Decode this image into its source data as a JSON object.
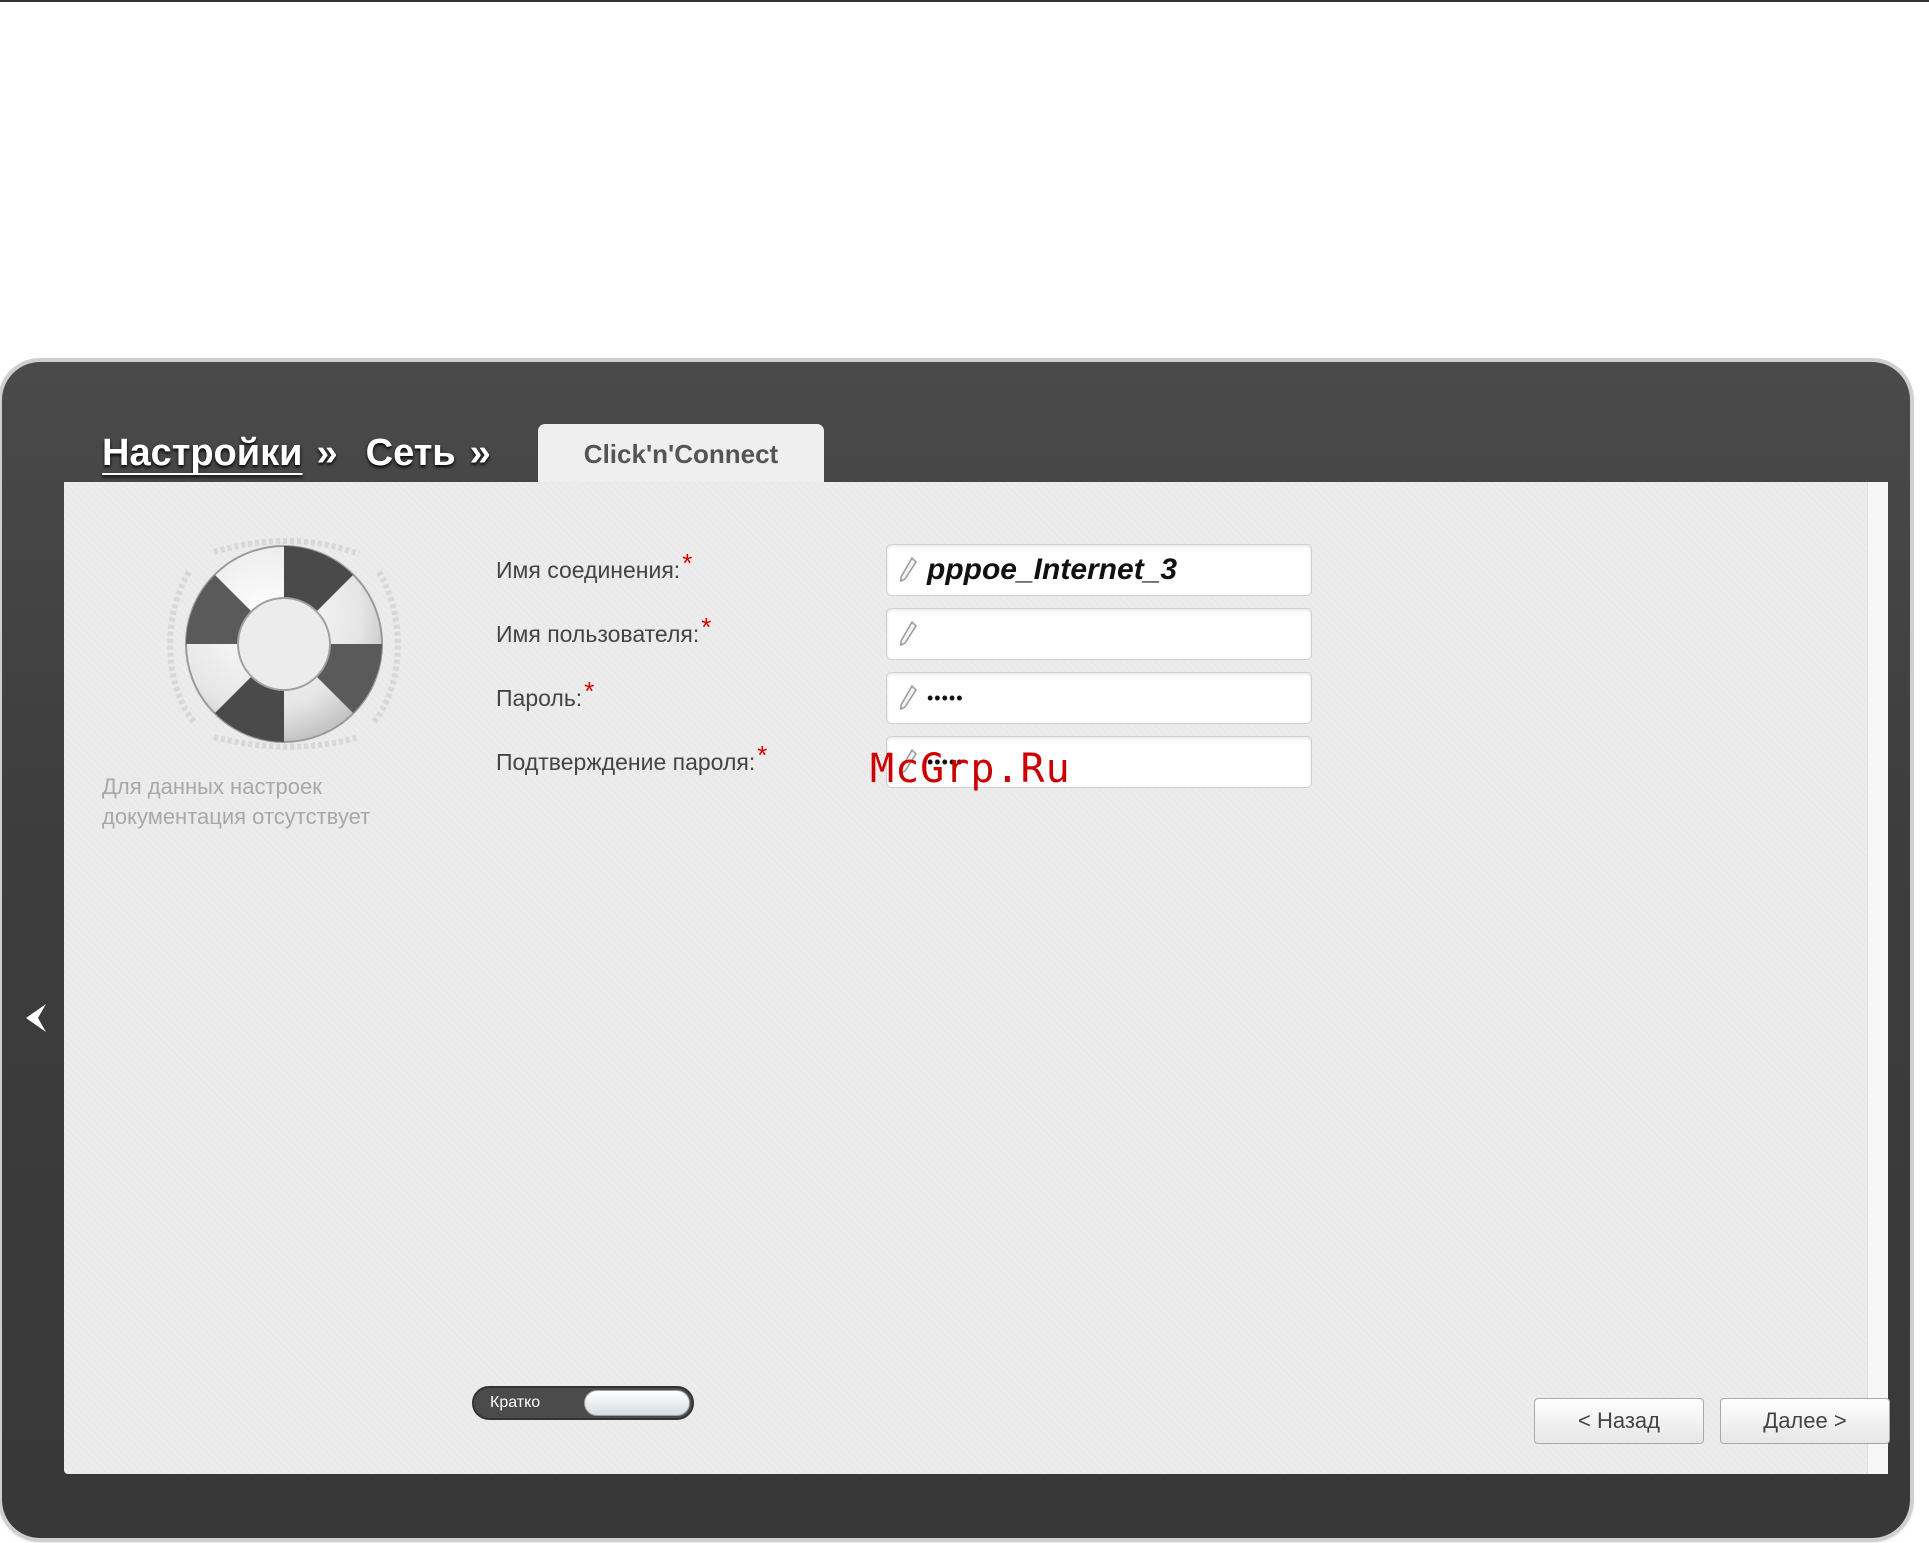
{
  "breadcrumb": {
    "items": [
      "Настройки",
      "Сеть"
    ],
    "separator": "»",
    "active_tab": "Click'n'Connect"
  },
  "help": {
    "icon": "lifebuoy-icon",
    "text": "Для данных настроек документация отсутствует"
  },
  "form": {
    "fields": [
      {
        "label": "Имя соединения:",
        "required_mark": "*",
        "value": "pppoe_Internet_3"
      },
      {
        "label": "Имя пользователя:",
        "required_mark": "*",
        "value": ""
      },
      {
        "label": "Пароль:",
        "required_mark": "*",
        "value": "•••••"
      },
      {
        "label": "Подтверждение пароля:",
        "required_mark": "*",
        "value": "•••••"
      }
    ]
  },
  "view_toggle": {
    "label": "Кратко"
  },
  "buttons": {
    "back": "< Назад",
    "next": "Далее >"
  },
  "watermark": "McGrp.Ru",
  "colors": {
    "frame": "#3d3d3d",
    "panel": "#ececec",
    "required": "#d40000",
    "watermark": "#cc0000"
  }
}
